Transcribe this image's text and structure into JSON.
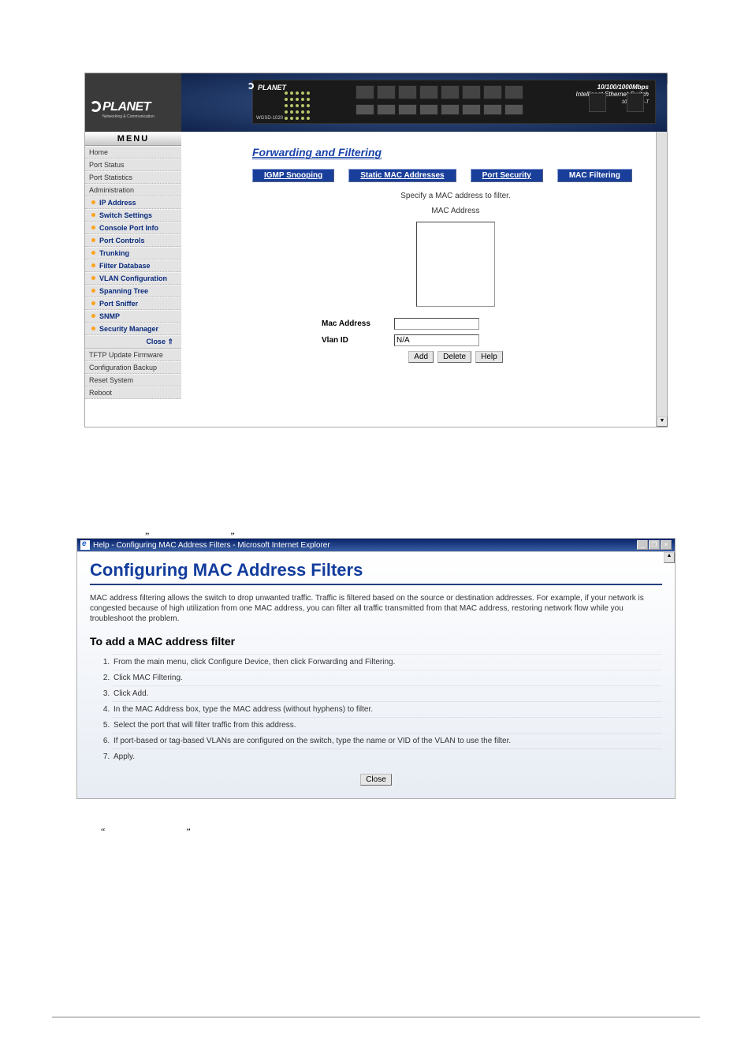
{
  "logo_text": "PLANET",
  "logo_sub": "Networking & Communication",
  "menu_header": "MENU",
  "menu": {
    "home": "Home",
    "port_status": "Port Status",
    "port_statistics": "Port Statistics",
    "administration": "Administration",
    "items": [
      "IP Address",
      "Switch Settings",
      "Console Port Info",
      "Port Controls",
      "Trunking",
      "Filter Database",
      "VLAN Configuration",
      "Spanning Tree",
      "Port Sniffer",
      "SNMP",
      "Security Manager"
    ],
    "close": "Close",
    "tftp": "TFTP Update Firmware",
    "cfg": "Configuration Backup",
    "reset": "Reset System",
    "reboot": "Reboot"
  },
  "device": {
    "brand": "PLANET",
    "model": "WGSD-1020",
    "speed": "10/100/1000Mbps",
    "desc": "Intelligent Ethernet Switch",
    "base": "1000 Base-T"
  },
  "page_title": "Forwarding and Filtering",
  "tabs": [
    "IGMP Snooping",
    "Static MAC Addresses",
    "Port Security",
    "MAC Filtering"
  ],
  "instruction": "Specify a MAC address to filter.",
  "list_label": "MAC Address",
  "form": {
    "mac_label": "Mac Address",
    "vlan_label": "Vlan ID",
    "vlan_placeholder": "N/A"
  },
  "buttons": {
    "add": "Add",
    "delete": "Delete",
    "help": "Help"
  },
  "help_window": {
    "title": "Help - Configuring MAC Address Filters - Microsoft Internet Explorer",
    "h1": "Configuring MAC Address Filters",
    "intro": "MAC address filtering allows the switch to drop unwanted traffic. Traffic is filtered based on the source or destination addresses. For example, if your network is congested because of high utilization from one MAC address, you can filter all traffic transmitted from that MAC address, restoring network flow while you troubleshoot the problem.",
    "h2": "To add a MAC address filter",
    "steps": [
      "From the main menu, click Configure Device, then click Forwarding and Filtering.",
      "Click MAC Filtering.",
      "Click Add.",
      "In the MAC Address box, type the MAC address (without hyphens) to filter.",
      "Select the port that will filter traffic from this address.",
      "If port-based or tag-based VLANs are configured on the switch, type the name or VID of the VLAN to use the filter.",
      "Apply."
    ],
    "close": "Close"
  },
  "quotes_top": "” ”",
  "quotes_bottom": "“ ”"
}
